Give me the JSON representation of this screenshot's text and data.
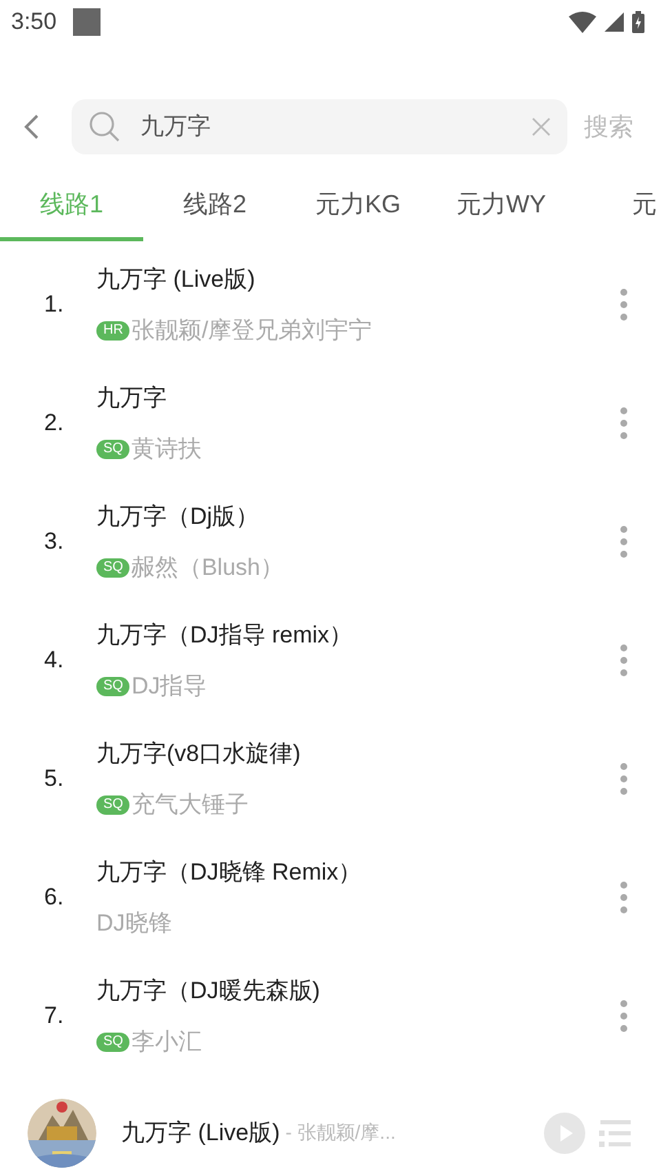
{
  "status_bar": {
    "time": "3:50"
  },
  "search": {
    "value": "九万字",
    "button": "搜索"
  },
  "tabs": [
    {
      "label": "线路1",
      "selected": true
    },
    {
      "label": "线路2",
      "selected": false
    },
    {
      "label": "元力KG",
      "selected": false
    },
    {
      "label": "元力WY",
      "selected": false
    },
    {
      "label": "元",
      "selected": false
    }
  ],
  "songs": [
    {
      "number": "1.",
      "title": "九万字 (Live版)",
      "quality": "HR",
      "artist": "张靓颖/摩登兄弟刘宇宁"
    },
    {
      "number": "2.",
      "title": "九万字",
      "quality": "SQ",
      "artist": "黄诗扶"
    },
    {
      "number": "3.",
      "title": "九万字（Dj版）",
      "quality": "SQ",
      "artist": "赧然（Blush）"
    },
    {
      "number": "4.",
      "title": "九万字（DJ指导 remix）",
      "quality": "SQ",
      "artist": "DJ指导"
    },
    {
      "number": "5.",
      "title": "九万字(v8口水旋律)",
      "quality": "SQ",
      "artist": "充气大锤子"
    },
    {
      "number": "6.",
      "title": "九万字（DJ晓锋 Remix）",
      "artist": "DJ晓锋"
    },
    {
      "number": "7.",
      "title": "九万字（DJ暖先森版)",
      "quality": "SQ",
      "artist": "李小汇"
    }
  ],
  "player": {
    "title": "九万字 (Live版)",
    "artist": "- 张靓颖/摩..."
  }
}
